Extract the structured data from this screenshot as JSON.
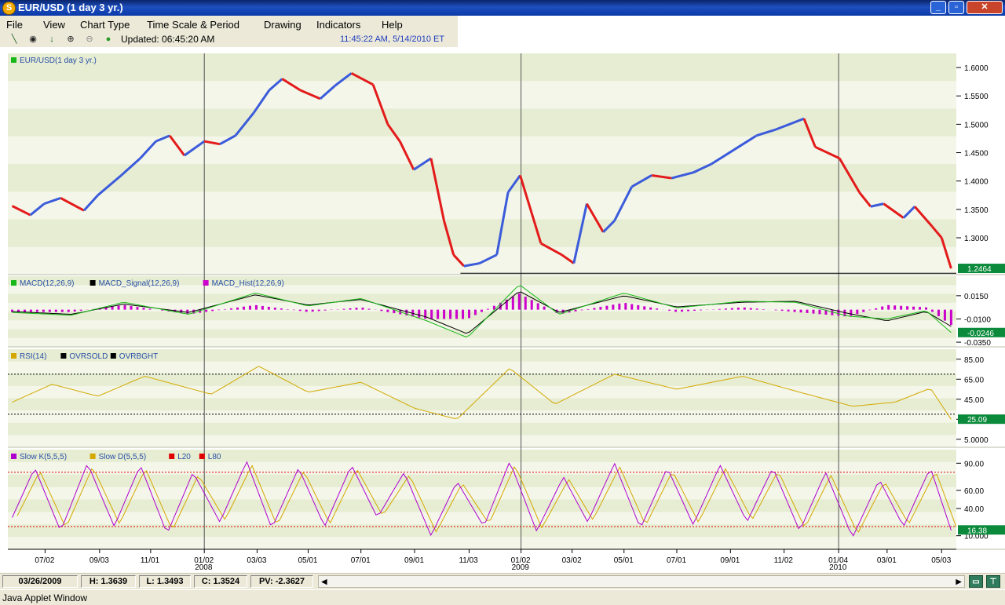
{
  "window": {
    "title": "EUR/USD (1 day  3 yr.)",
    "app_icon": "s-logo-icon",
    "controls": [
      "minimize",
      "maximize",
      "close"
    ]
  },
  "menu": [
    "File",
    "View",
    "Chart Type",
    "Time Scale & Period",
    "Drawing",
    "Indicators",
    "Help"
  ],
  "toolbar": {
    "icons": [
      "line-draw-icon",
      "crosshair-icon",
      "arrow-down-icon",
      "zoom-in-icon",
      "zoom-out-icon",
      "status-dot-icon"
    ],
    "updated": "Updated: 06:45:20 AM",
    "clock": "11:45:22 AM, 5/14/2010 ET"
  },
  "status": {
    "date": "03/26/2009",
    "high": "H: 1.3639",
    "low": "L: 1.3493",
    "close": "C: 1.3524",
    "pv": "PV: -2.3627"
  },
  "footer": "Java Applet Window",
  "chart_data": [
    {
      "type": "candlestick",
      "title": "EUR/USD(1 day  3 yr.)",
      "legend": [
        "EUR/USD(1 day  3 yr.)"
      ],
      "yticks": [
        "1.6000",
        "1.5500",
        "1.5000",
        "1.4500",
        "1.4000",
        "1.3500",
        "1.3000"
      ],
      "ylim": [
        1.235,
        1.625
      ],
      "last_value": "1.2464",
      "support_line": 1.2375,
      "colors": {
        "up": "#3b5bdb",
        "down": "#e31b1b"
      },
      "x": [
        "2007-05-25",
        "2007-06-15",
        "2007-07-01",
        "2007-07-20",
        "2007-08-16",
        "2007-09-01",
        "2007-09-28",
        "2007-10-20",
        "2007-11-07",
        "2007-11-23",
        "2007-12-10",
        "2008-01-02",
        "2008-01-20",
        "2008-02-07",
        "2008-02-28",
        "2008-03-17",
        "2008-04-01",
        "2008-04-22",
        "2008-05-15",
        "2008-06-01",
        "2008-06-20",
        "2008-07-15",
        "2008-08-01",
        "2008-08-15",
        "2008-08-31",
        "2008-09-20",
        "2008-10-05",
        "2008-10-16",
        "2008-10-28",
        "2008-11-15",
        "2008-12-05",
        "2008-12-18",
        "2009-01-01",
        "2009-01-25",
        "2009-02-18",
        "2009-03-04",
        "2009-03-19",
        "2009-04-07",
        "2009-04-20",
        "2009-05-10",
        "2009-06-02",
        "2009-06-25",
        "2009-07-20",
        "2009-08-10",
        "2009-09-05",
        "2009-10-01",
        "2009-10-22",
        "2009-11-25",
        "2009-12-08",
        "2010-01-05",
        "2010-01-28",
        "2010-02-10",
        "2010-02-25",
        "2010-03-20",
        "2010-04-02",
        "2010-04-22",
        "2010-05-03",
        "2010-05-14"
      ],
      "close": [
        1.356,
        1.34,
        1.36,
        1.37,
        1.348,
        1.375,
        1.41,
        1.44,
        1.47,
        1.48,
        1.445,
        1.47,
        1.465,
        1.48,
        1.52,
        1.56,
        1.58,
        1.56,
        1.545,
        1.568,
        1.59,
        1.57,
        1.5,
        1.47,
        1.42,
        1.44,
        1.33,
        1.27,
        1.25,
        1.255,
        1.27,
        1.38,
        1.41,
        1.29,
        1.27,
        1.255,
        1.36,
        1.31,
        1.33,
        1.39,
        1.41,
        1.405,
        1.415,
        1.43,
        1.455,
        1.48,
        1.49,
        1.51,
        1.46,
        1.44,
        1.38,
        1.355,
        1.36,
        1.335,
        1.355,
        1.32,
        1.3,
        1.246
      ]
    },
    {
      "type": "line",
      "legend": [
        "MACD(12,26,9)",
        "MACD_Signal(12,26,9)",
        "MACD_Hist(12,26,9)"
      ],
      "yticks": [
        "0.0150",
        "-0.0100",
        "-0.0350"
      ],
      "ylim": [
        -0.04,
        0.036
      ],
      "last_value": "-0.0246",
      "colors": {
        "macd": "#18b818",
        "signal": "#000000",
        "hist": "#cc00cc"
      },
      "series": [
        {
          "name": "MACD(12,26,9)",
          "x": [
            "2007-05-25",
            "2007-08-01",
            "2007-10-01",
            "2007-12-15",
            "2008-03-01",
            "2008-05-01",
            "2008-07-01",
            "2008-09-15",
            "2008-11-01",
            "2008-12-31",
            "2009-02-15",
            "2009-05-01",
            "2009-07-01",
            "2009-09-15",
            "2009-11-15",
            "2010-01-15",
            "2010-03-01",
            "2010-04-15",
            "2010-05-14"
          ],
          "values": [
            -0.003,
            -0.006,
            0.008,
            -0.005,
            0.018,
            0.004,
            0.012,
            -0.012,
            -0.03,
            0.027,
            -0.005,
            0.018,
            0.002,
            0.009,
            0.008,
            -0.007,
            -0.01,
            -0.001,
            -0.0246
          ]
        },
        {
          "name": "MACD_Signal(12,26,9)",
          "x": [
            "2007-05-25",
            "2007-08-01",
            "2007-10-01",
            "2007-12-15",
            "2008-03-01",
            "2008-05-01",
            "2008-07-01",
            "2008-09-15",
            "2008-11-01",
            "2008-12-31",
            "2009-02-15",
            "2009-05-01",
            "2009-07-01",
            "2009-09-15",
            "2009-11-15",
            "2010-01-15",
            "2010-03-01",
            "2010-04-15",
            "2010-05-14"
          ],
          "values": [
            -0.002,
            -0.005,
            0.006,
            -0.003,
            0.016,
            0.005,
            0.011,
            -0.008,
            -0.026,
            0.02,
            -0.003,
            0.015,
            0.003,
            0.008,
            0.009,
            -0.004,
            -0.012,
            -0.002,
            -0.018
          ]
        }
      ]
    },
    {
      "type": "line",
      "legend": [
        "RSI(14)",
        "OVRSOLD",
        "OVRBGHT"
      ],
      "yticks": [
        "85.00",
        "65.00",
        "45.00",
        "25.00",
        "5.0000"
      ],
      "ylim": [
        -3,
        95
      ],
      "last_value": "25.09",
      "levels": {
        "OVRSOLD": 30,
        "OVRBGHT": 70
      },
      "colors": {
        "rsi": "#d4a800",
        "levels": "#000000"
      },
      "series": [
        {
          "name": "RSI(14)",
          "x": [
            "2007-05-25",
            "2007-07-10",
            "2007-09-01",
            "2007-10-25",
            "2008-01-10",
            "2008-03-05",
            "2008-05-01",
            "2008-07-01",
            "2008-09-01",
            "2008-10-20",
            "2008-12-20",
            "2009-02-10",
            "2009-04-20",
            "2009-07-01",
            "2009-09-15",
            "2009-11-20",
            "2010-01-20",
            "2010-03-10",
            "2010-04-20",
            "2010-05-14"
          ],
          "values": [
            42,
            60,
            48,
            68,
            50,
            78,
            52,
            62,
            36,
            25,
            76,
            40,
            70,
            55,
            68,
            52,
            38,
            42,
            56,
            25
          ]
        }
      ]
    },
    {
      "type": "line",
      "legend": [
        "Slow K(5,5,5)",
        "Slow D(5,5,5)",
        "L20",
        "L80"
      ],
      "yticks": [
        "90.00",
        "60.00",
        "40.00",
        "10.000"
      ],
      "ylim": [
        -5,
        105
      ],
      "last_value": "16.38",
      "levels": {
        "L20": 20,
        "L80": 80
      },
      "colors": {
        "k": "#b000d0",
        "d": "#d4a800",
        "levels": "#e00000"
      },
      "series": [
        {
          "name": "Slow K(5,5,5)",
          "x": [
            "2007-05-25",
            "2007-06-20",
            "2007-07-20",
            "2007-08-20",
            "2007-09-20",
            "2007-10-20",
            "2007-11-20",
            "2007-12-20",
            "2008-01-20",
            "2008-02-20",
            "2008-03-20",
            "2008-04-20",
            "2008-05-20",
            "2008-06-20",
            "2008-07-20",
            "2008-08-20",
            "2008-09-20",
            "2008-10-20",
            "2008-11-20",
            "2008-12-20",
            "2009-01-20",
            "2009-02-20",
            "2009-03-20",
            "2009-04-20",
            "2009-05-20",
            "2009-06-20",
            "2009-07-20",
            "2009-08-20",
            "2009-09-20",
            "2009-10-20",
            "2009-11-20",
            "2009-12-20",
            "2010-01-20",
            "2010-02-20",
            "2010-03-20",
            "2010-04-20",
            "2010-05-14"
          ],
          "values": [
            30,
            85,
            15,
            90,
            20,
            88,
            12,
            80,
            25,
            92,
            18,
            85,
            20,
            88,
            30,
            80,
            10,
            70,
            20,
            92,
            15,
            75,
            25,
            90,
            18,
            85,
            22,
            88,
            25,
            85,
            15,
            80,
            8,
            72,
            20,
            85,
            16
          ]
        }
      ]
    }
  ],
  "x_axis": {
    "labels": [
      "07/02",
      "09/03",
      "11/01",
      "01/02",
      "03/03",
      "05/01",
      "07/01",
      "09/01",
      "11/03",
      "01/02",
      "03/02",
      "05/01",
      "07/01",
      "09/01",
      "11/02",
      "01/04",
      "03/01",
      "05/03"
    ],
    "year_labels": [
      "2008",
      "2009",
      "2010"
    ]
  }
}
